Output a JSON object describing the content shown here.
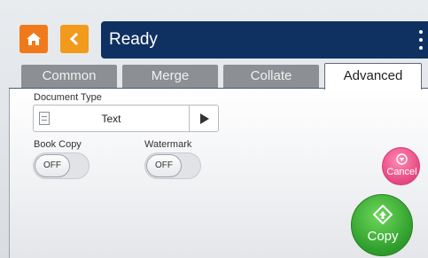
{
  "header": {
    "status": "Ready",
    "home_icon": "home-icon",
    "back_icon": "chevron-left-icon",
    "menu_icon": "kebab-menu-icon"
  },
  "tabs": [
    {
      "label": "Common",
      "active": false
    },
    {
      "label": "Merge",
      "active": false
    },
    {
      "label": "Collate",
      "active": false
    },
    {
      "label": "Advanced",
      "active": true
    }
  ],
  "document_type": {
    "label": "Document Type",
    "value": "Text",
    "icon": "document-icon",
    "arrow_icon": "play-arrow-icon"
  },
  "book_copy": {
    "label": "Book Copy",
    "state": "OFF"
  },
  "watermark": {
    "label": "Watermark",
    "state": "OFF"
  },
  "cancel": {
    "label": "Cancel",
    "icon": "stop-icon"
  },
  "copy": {
    "label": "Copy",
    "icon": "start-icon"
  },
  "colors": {
    "title_bar": "#0f3161",
    "home": "#f07a1a",
    "back": "#f29a1c",
    "cancel": "#e6477f",
    "copy": "#2c9a2a"
  }
}
